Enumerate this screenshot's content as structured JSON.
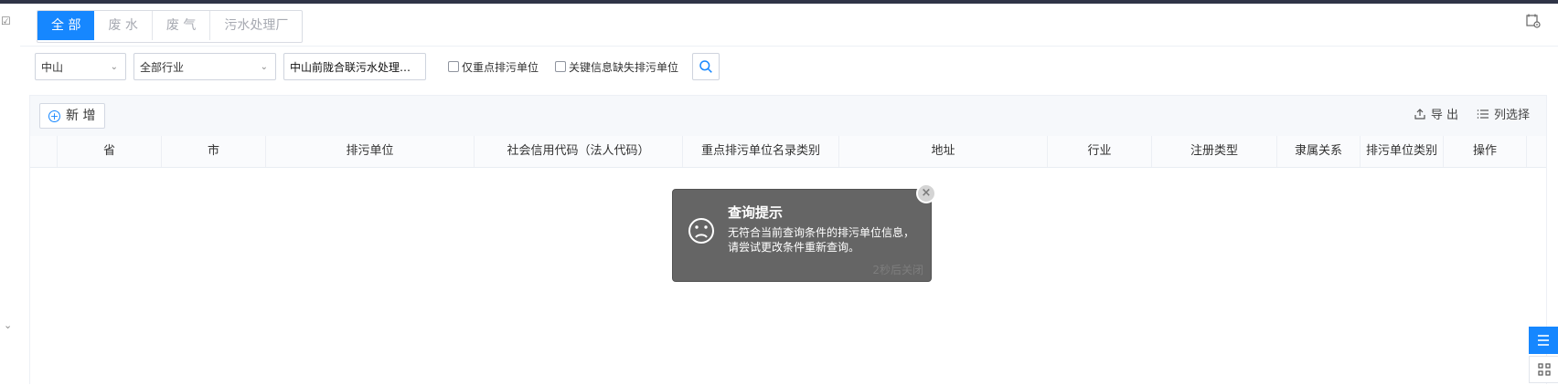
{
  "tabs": [
    {
      "label": "全 部",
      "active": true
    },
    {
      "label": "废 水",
      "active": false
    },
    {
      "label": "废 气",
      "active": false
    },
    {
      "label": "污水处理厂",
      "active": false
    }
  ],
  "filters": {
    "city_value": "中山",
    "industry_value": "全部行业",
    "unit_input_value": "中山前陇合联污水处理有限公司",
    "check1_label": "仅重点排污单位",
    "check2_label": "关键信息缺失排污单位"
  },
  "toolbar": {
    "add_label": "新 增",
    "export_label": "导 出",
    "columns_label": "列选择"
  },
  "table": {
    "columns": [
      "",
      "省",
      "市",
      "排污单位",
      "社会信用代码（法人代码）",
      "重点排污单位名录类别",
      "地址",
      "行业",
      "注册类型",
      "隶属关系",
      "排污单位类别",
      "操作",
      ""
    ]
  },
  "toast": {
    "title": "查询提示",
    "message": "无符合当前查询条件的排污单位信息，\n请尝试更改条件重新查询。",
    "footer": "2秒后关闭"
  },
  "colors": {
    "accent": "#1687ff",
    "toast_bg": "#656565"
  },
  "icons": {
    "search": "search-icon",
    "close": "close-icon",
    "export": "upload-icon",
    "columns": "list-icon",
    "sad": "sad-face-icon"
  }
}
